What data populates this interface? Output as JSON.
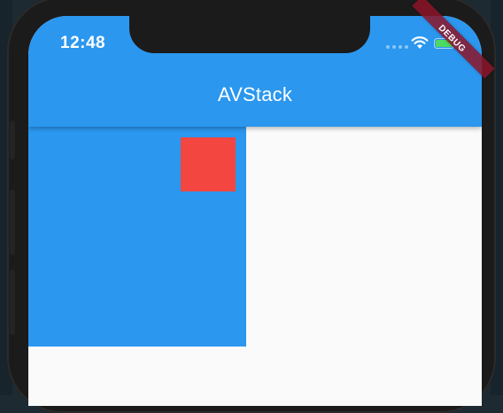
{
  "status_bar": {
    "time": "12:48",
    "icons": [
      "signal-dots-icon",
      "wifi-icon",
      "battery-icon"
    ],
    "battery_color": "#4cd964"
  },
  "app_bar": {
    "title": "AVStack",
    "color": "#2b97ef"
  },
  "content": {
    "container_color": "#2b97ef",
    "child_color": "#f44640"
  },
  "debug_banner": {
    "label": "DEBUG",
    "color": "#8c1428"
  }
}
